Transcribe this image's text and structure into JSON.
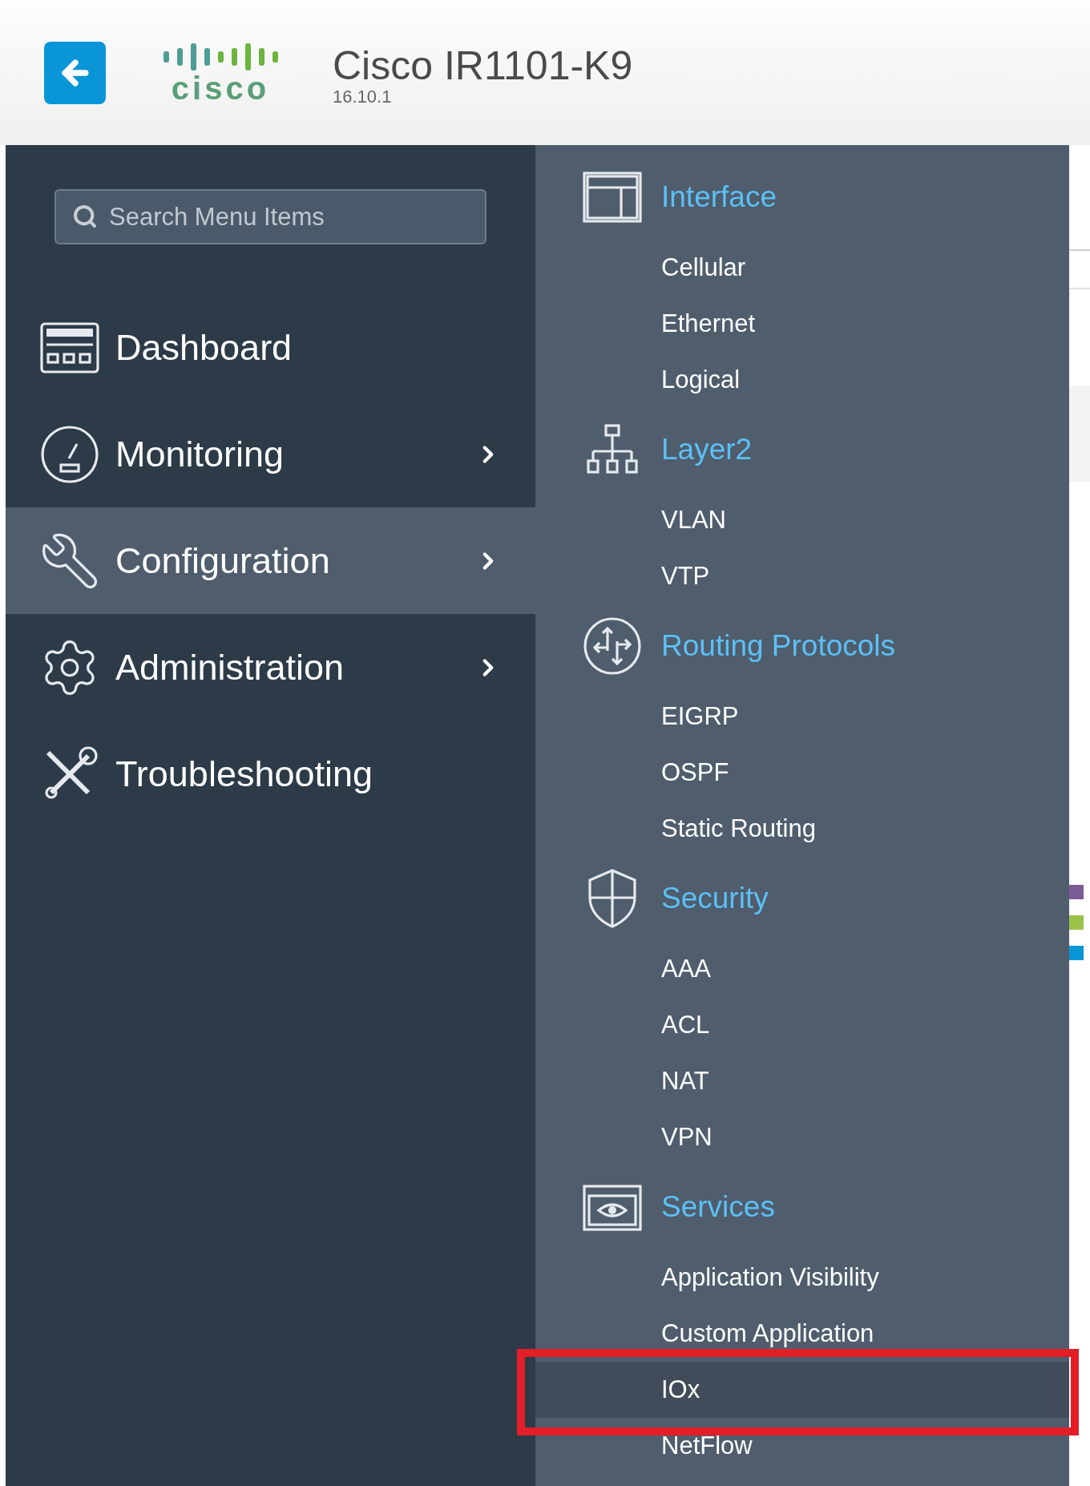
{
  "header": {
    "logo_text": "cisco",
    "title": "Cisco IR1101-K9",
    "version": "16.10.1"
  },
  "search": {
    "placeholder": "Search Menu Items"
  },
  "menu": [
    {
      "label": "Dashboard",
      "selected": false,
      "has_submenu": false
    },
    {
      "label": "Monitoring",
      "selected": false,
      "has_submenu": true
    },
    {
      "label": "Configuration",
      "selected": true,
      "has_submenu": true
    },
    {
      "label": "Administration",
      "selected": false,
      "has_submenu": true
    },
    {
      "label": "Troubleshooting",
      "selected": false,
      "has_submenu": false
    }
  ],
  "submenu": [
    {
      "title": "Interface",
      "items": [
        {
          "label": "Cellular",
          "selected": false
        },
        {
          "label": "Ethernet",
          "selected": false
        },
        {
          "label": "Logical",
          "selected": false
        }
      ]
    },
    {
      "title": "Layer2",
      "items": [
        {
          "label": "VLAN",
          "selected": false
        },
        {
          "label": "VTP",
          "selected": false
        }
      ]
    },
    {
      "title": "Routing Protocols",
      "items": [
        {
          "label": "EIGRP",
          "selected": false
        },
        {
          "label": "OSPF",
          "selected": false
        },
        {
          "label": "Static Routing",
          "selected": false
        }
      ]
    },
    {
      "title": "Security",
      "items": [
        {
          "label": "AAA",
          "selected": false
        },
        {
          "label": "ACL",
          "selected": false
        },
        {
          "label": "NAT",
          "selected": false
        },
        {
          "label": "VPN",
          "selected": false
        }
      ]
    },
    {
      "title": "Services",
      "items": [
        {
          "label": "Application Visibility",
          "selected": false
        },
        {
          "label": "Custom Application",
          "selected": false
        },
        {
          "label": "IOx",
          "selected": true
        },
        {
          "label": "NetFlow",
          "selected": false
        }
      ]
    }
  ]
}
